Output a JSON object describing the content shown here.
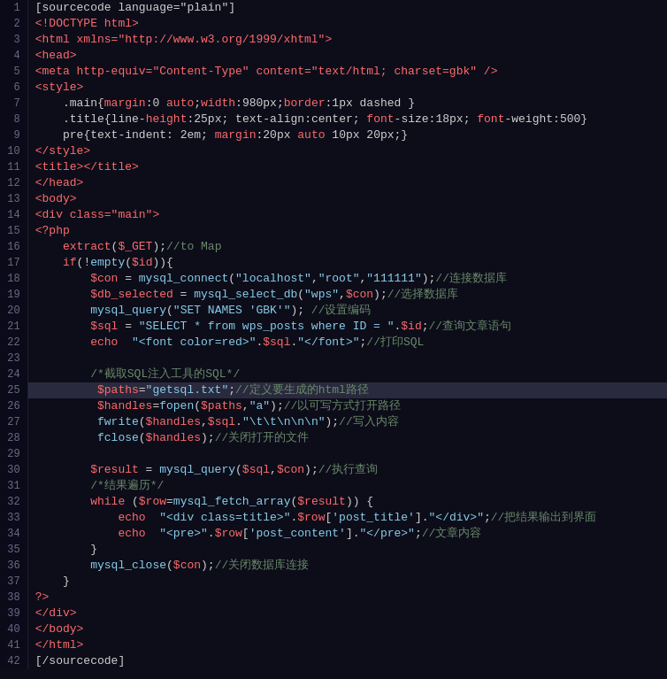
{
  "lines": [
    {
      "num": 1,
      "tokens": [
        {
          "t": "[sourcecode language=\"plain\"]",
          "c": "c-plain"
        }
      ]
    },
    {
      "num": 2,
      "tokens": [
        {
          "t": "<!DOCTYPE html>",
          "c": "c-tag"
        }
      ]
    },
    {
      "num": 3,
      "tokens": [
        {
          "t": "<html xmlns=\"http://www.w3.org/1999/xhtml\">",
          "c": ""
        }
      ]
    },
    {
      "num": 4,
      "tokens": [
        {
          "t": "<head>",
          "c": "c-tag"
        }
      ]
    },
    {
      "num": 5,
      "tokens": [
        {
          "t": "<meta http-equiv=\"Content-Type\" content=\"text/html; charset=gbk\" />",
          "c": ""
        }
      ]
    },
    {
      "num": 6,
      "tokens": [
        {
          "t": "<style>",
          "c": "c-tag"
        }
      ]
    },
    {
      "num": 7,
      "tokens": [
        {
          "t": "    .main{margin:0 auto;width:980px;border:1px dashed }",
          "c": ""
        }
      ]
    },
    {
      "num": 8,
      "tokens": [
        {
          "t": "    .title{line-height:25px; text-align:center; font-size:18px; font-weight:500}",
          "c": ""
        }
      ]
    },
    {
      "num": 9,
      "tokens": [
        {
          "t": "    pre{text-indent: 2em; margin:20px auto 10px 20px;}",
          "c": ""
        }
      ]
    },
    {
      "num": 10,
      "tokens": [
        {
          "t": "</style>",
          "c": "c-tag"
        }
      ]
    },
    {
      "num": 11,
      "tokens": [
        {
          "t": "<title></title>",
          "c": "c-tag"
        }
      ]
    },
    {
      "num": 12,
      "tokens": [
        {
          "t": "</head>",
          "c": "c-tag"
        }
      ]
    },
    {
      "num": 13,
      "tokens": [
        {
          "t": "<body>",
          "c": "c-tag"
        }
      ]
    },
    {
      "num": 14,
      "tokens": [
        {
          "t": "<div class=\"main\">",
          "c": "c-tag"
        }
      ]
    },
    {
      "num": 15,
      "tokens": [
        {
          "t": "<?php",
          "c": "c-php"
        }
      ]
    },
    {
      "num": 16,
      "tokens": [
        {
          "t": "    extract($_GET);//to Map",
          "c": ""
        }
      ]
    },
    {
      "num": 17,
      "tokens": [
        {
          "t": "    if(!empty($id)){",
          "c": ""
        }
      ]
    },
    {
      "num": 18,
      "tokens": [
        {
          "t": "        $con = mysql_connect(\"localhost\",\"root\",\"111111\");//连接数据库",
          "c": ""
        }
      ]
    },
    {
      "num": 19,
      "tokens": [
        {
          "t": "        $db_selected = mysql_select_db(\"wps\",$con);//选择数据库",
          "c": ""
        }
      ]
    },
    {
      "num": 20,
      "tokens": [
        {
          "t": "        mysql_query(\"SET NAMES 'GBK'\"); //设置编码",
          "c": ""
        }
      ]
    },
    {
      "num": 21,
      "tokens": [
        {
          "t": "        $sql = \"SELECT * from wps_posts where ID = \".$id;//查询文章语句",
          "c": ""
        }
      ]
    },
    {
      "num": 22,
      "tokens": [
        {
          "t": "        echo  \"<font color=red>\".$sql.\"</font>\";//打印SQL",
          "c": ""
        }
      ]
    },
    {
      "num": 23,
      "tokens": [
        {
          "t": "",
          "c": ""
        }
      ]
    },
    {
      "num": 24,
      "tokens": [
        {
          "t": "        /*截取SQL注入工具的SQL*/",
          "c": "c-comment"
        }
      ]
    },
    {
      "num": 25,
      "tokens": [
        {
          "t": "         $paths=\"getsql.txt\";//定义要生成的html路径",
          "c": ""
        }
      ]
    },
    {
      "num": 26,
      "tokens": [
        {
          "t": "         $handles=fopen($paths,\"a\");//以可写方式打开路径",
          "c": ""
        }
      ]
    },
    {
      "num": 27,
      "tokens": [
        {
          "t": "         fwrite($handles,$sql.\"\\t\\t\\n\\n\\n\");//写入内容",
          "c": ""
        }
      ]
    },
    {
      "num": 28,
      "tokens": [
        {
          "t": "         fclose($handles);//关闭打开的文件",
          "c": ""
        }
      ]
    },
    {
      "num": 29,
      "tokens": [
        {
          "t": "",
          "c": ""
        }
      ]
    },
    {
      "num": 30,
      "tokens": [
        {
          "t": "        $result = mysql_query($sql,$con);//执行查询",
          "c": ""
        }
      ]
    },
    {
      "num": 31,
      "tokens": [
        {
          "t": "        /*结果遍历*/",
          "c": "c-comment"
        }
      ]
    },
    {
      "num": 32,
      "tokens": [
        {
          "t": "        while ($row=mysql_fetch_array($result)) {",
          "c": ""
        }
      ]
    },
    {
      "num": 33,
      "tokens": [
        {
          "t": "            echo  \"<div class=title>\".$row['post_title'].\"</div>\";//把结果输出到界面",
          "c": ""
        }
      ]
    },
    {
      "num": 34,
      "tokens": [
        {
          "t": "            echo  \"<pre>\".$row['post_content'].\"</pre>\";//文章内容",
          "c": ""
        }
      ]
    },
    {
      "num": 35,
      "tokens": [
        {
          "t": "        }",
          "c": ""
        }
      ]
    },
    {
      "num": 36,
      "tokens": [
        {
          "t": "        mysql_close($con);//关闭数据库连接",
          "c": ""
        }
      ]
    },
    {
      "num": 37,
      "tokens": [
        {
          "t": "    }",
          "c": ""
        }
      ]
    },
    {
      "num": 38,
      "tokens": [
        {
          "t": "?>",
          "c": "c-php"
        }
      ]
    },
    {
      "num": 39,
      "tokens": [
        {
          "t": "</div>",
          "c": "c-tag"
        }
      ]
    },
    {
      "num": 40,
      "tokens": [
        {
          "t": "</body>",
          "c": "c-tag"
        }
      ]
    },
    {
      "num": 41,
      "tokens": [
        {
          "t": "</html>",
          "c": "c-tag"
        }
      ]
    },
    {
      "num": 42,
      "tokens": [
        {
          "t": "[/sourcecode]",
          "c": "c-plain"
        }
      ]
    }
  ]
}
